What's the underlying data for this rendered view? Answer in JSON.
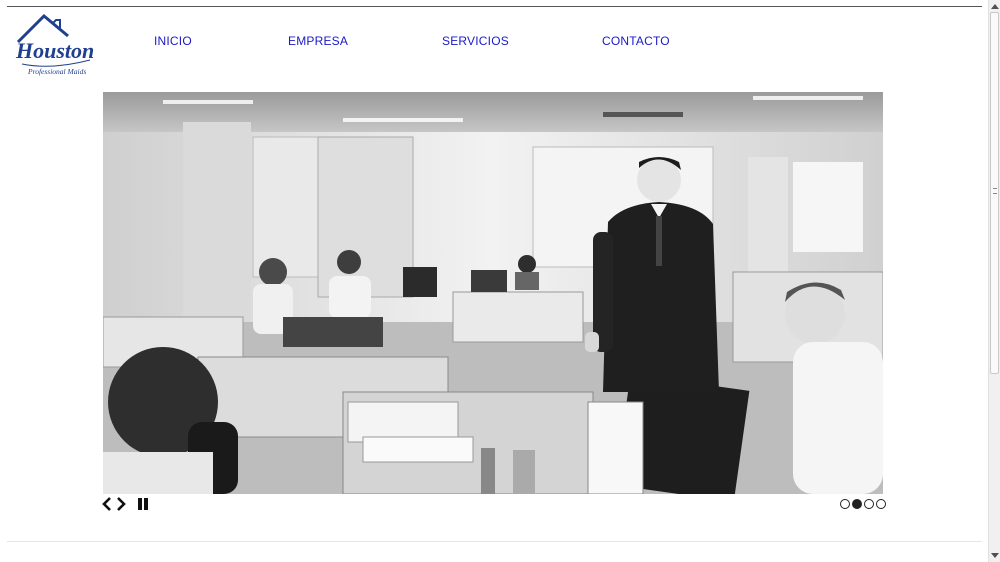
{
  "logo": {
    "brand": "Houston",
    "tagline": "Professional Maids"
  },
  "nav": {
    "items": [
      {
        "label": "INICIO"
      },
      {
        "label": "EMPRESA"
      },
      {
        "label": "SERVICIOS"
      },
      {
        "label": "CONTACTO"
      }
    ]
  },
  "slider": {
    "slide_count": 4,
    "active_index": 1,
    "image_subject": "office-photo-grayscale"
  },
  "colors": {
    "nav_link": "#1a1ac8",
    "logo_blue": "#1f3f8f"
  }
}
